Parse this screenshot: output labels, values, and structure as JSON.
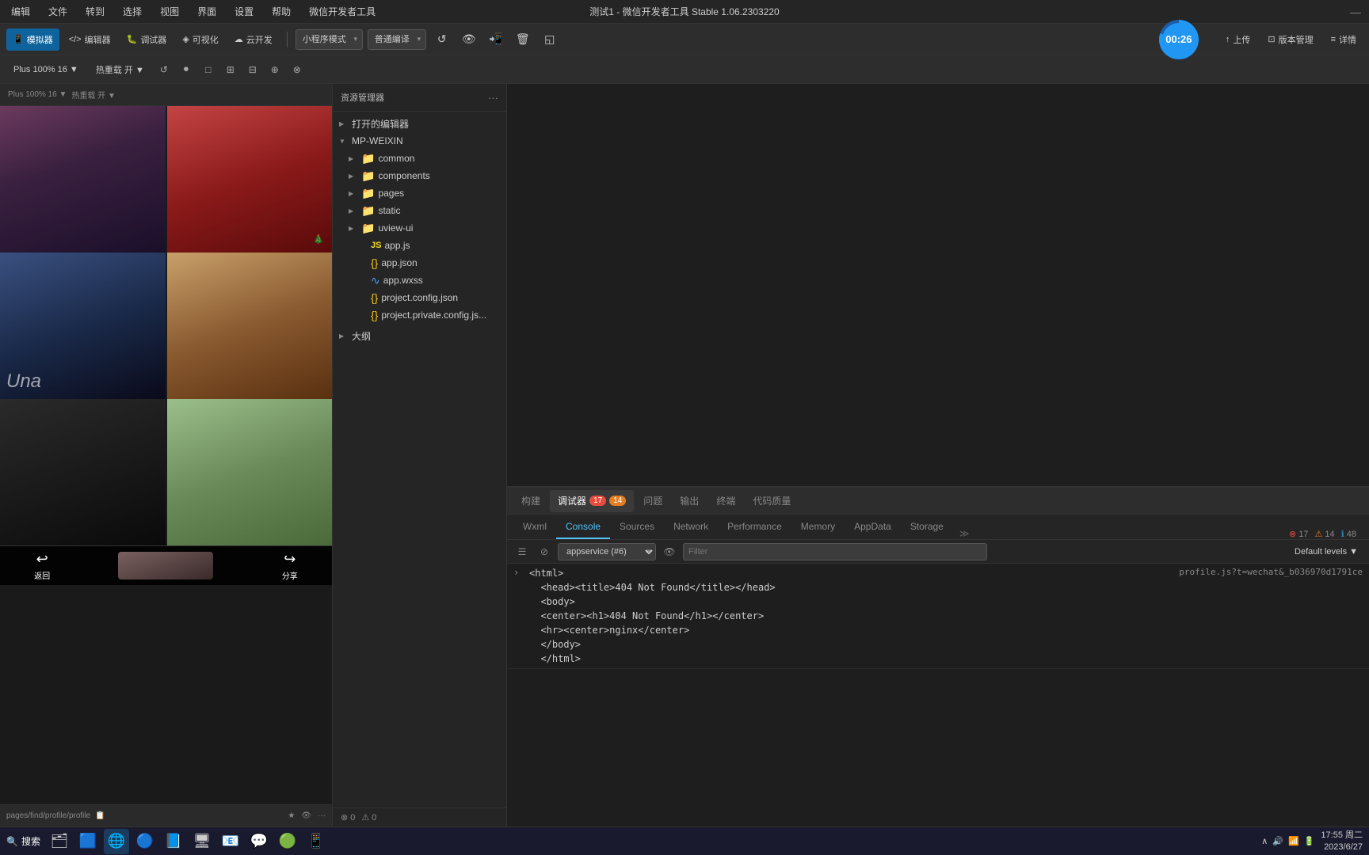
{
  "titleBar": {
    "menus": [
      "编辑",
      "文件",
      "转到",
      "选择",
      "视图",
      "界面",
      "设置",
      "帮助",
      "微信开发者工具"
    ],
    "title": "测试1 - 微信开发者工具 Stable 1.06.2303220",
    "close": "—"
  },
  "toolbar": {
    "mode_label": "小程序模式",
    "compile_label": "普通编译",
    "buttons": [
      "模拟器",
      "编辑器",
      "调试器",
      "可视化",
      "云开发"
    ],
    "right_buttons": [
      "上传",
      "版本管理",
      "详情"
    ],
    "icons": [
      "↑",
      "⊡",
      "≡"
    ]
  },
  "toolbar2": {
    "zoom_label": "Plus 100% 16 ▼",
    "hot_reload": "热重载 开 ▼",
    "icons": [
      "↺",
      "⏺",
      "□",
      "⊞",
      "⊟",
      "⊕",
      "⊗"
    ]
  },
  "timer": "00:26",
  "filePanel": {
    "header": "资源管理器",
    "more_icon": "···",
    "sections": [
      {
        "label": "打开的编辑器",
        "collapsed": true,
        "items": []
      },
      {
        "label": "MP-WEIXIN",
        "collapsed": false,
        "items": [
          {
            "name": "common",
            "type": "folder",
            "indent": 1
          },
          {
            "name": "components",
            "type": "folder",
            "indent": 1
          },
          {
            "name": "pages",
            "type": "folder",
            "indent": 1
          },
          {
            "name": "static",
            "type": "folder",
            "indent": 1
          },
          {
            "name": "uview-ui",
            "type": "folder",
            "indent": 1
          },
          {
            "name": "app.js",
            "type": "js",
            "indent": 1
          },
          {
            "name": "app.json",
            "type": "json",
            "indent": 1
          },
          {
            "name": "app.wxss",
            "type": "wxss",
            "indent": 1
          },
          {
            "name": "project.config.json",
            "type": "json",
            "indent": 1
          },
          {
            "name": "project.private.config.js...",
            "type": "json",
            "indent": 1
          }
        ]
      },
      {
        "label": "大纲",
        "collapsed": true,
        "items": []
      }
    ]
  },
  "devtools": {
    "tabs": [
      {
        "label": "构建",
        "active": false
      },
      {
        "label": "调试器",
        "active": true,
        "badge": "17, 14"
      },
      {
        "label": "问题",
        "active": false
      },
      {
        "label": "输出",
        "active": false
      },
      {
        "label": "终端",
        "active": false
      },
      {
        "label": "代码质量",
        "active": false
      }
    ],
    "panel_tabs": [
      "Wxml",
      "Console",
      "Sources",
      "Network",
      "Performance",
      "Memory",
      "AppData",
      "Storage"
    ],
    "active_panel_tab": "Console",
    "toolbar": {
      "icon_btns": [
        "☰",
        "⊘"
      ],
      "service_selector": "appservice (#6)",
      "eye_icon": "👁",
      "filter_placeholder": "Filter",
      "levels_label": "Default levels ▼"
    },
    "badges": {
      "red": "17",
      "orange": "14",
      "blue": "48"
    },
    "console_lines": [
      {
        "text": "<html>\n  <head><title>404 Not Found</title></head>\n  <body>\n  <center><h1>404 Not Found</h1></center>\n  <hr><center>nginx</center>\n  </body>\n  </html>",
        "link": "profile.js?t=wechat&_b036970d1791ce",
        "has_arrow": true
      }
    ],
    "console_arrow": "›"
  },
  "phone": {
    "status_left": [
      "Plus 100% 16 ▼",
      "热重载 开 ▼"
    ],
    "path": "pages/find/profile/profile",
    "footer_icons": [
      "★",
      "👁",
      "···"
    ],
    "back_label": "返回",
    "share_label": "分享"
  },
  "taskbar": {
    "search_label": "搜索",
    "apps": [
      "🗂",
      "🪟",
      "🔵",
      "🌐",
      "📘",
      "🖥",
      "📧",
      "🐉",
      "🟢",
      "📱"
    ],
    "time": "17:55 周二",
    "date": "2023/6/27",
    "sys_icons": [
      "∧",
      "🔊",
      "📶",
      "🔋"
    ]
  }
}
